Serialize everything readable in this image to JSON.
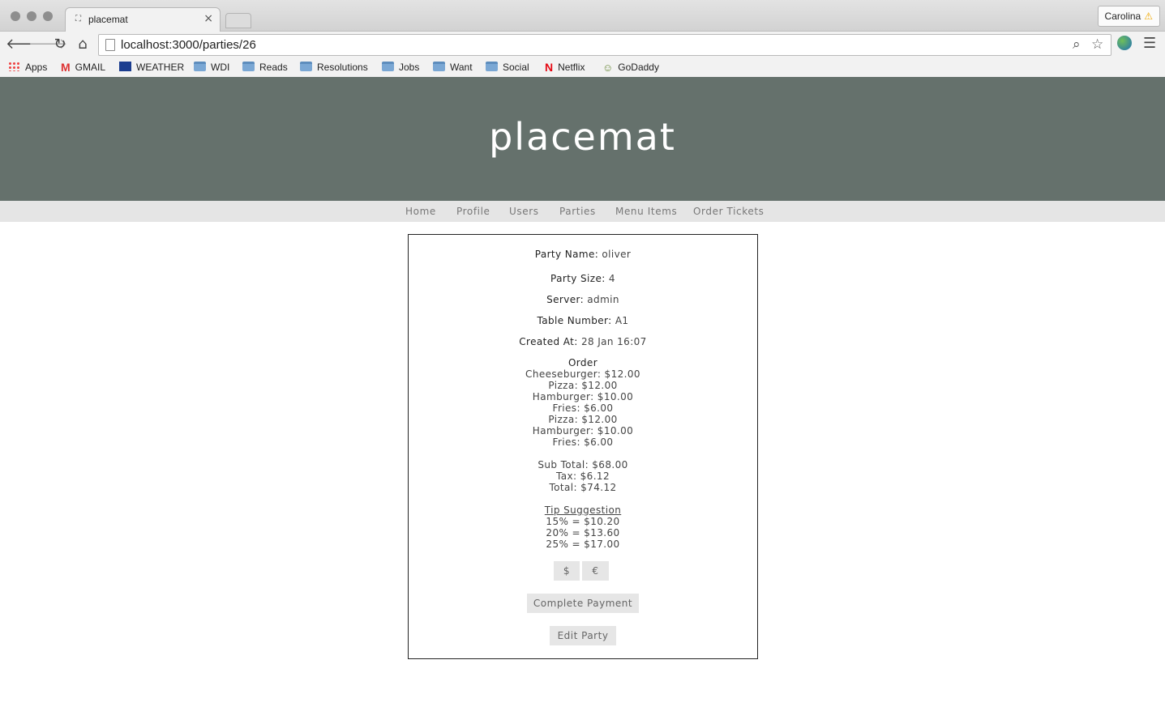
{
  "browser": {
    "tab_title": "placemat",
    "tab_close": "×",
    "url": "localhost:3000/parties/26",
    "profile_name": "Carolina",
    "bookmarks": [
      {
        "label": "Apps",
        "icon": "apps-icon"
      },
      {
        "label": "GMAIL",
        "icon": "gmail-icon"
      },
      {
        "label": "WEATHER",
        "icon": "weather-icon"
      },
      {
        "label": "WDI",
        "icon": "folder-icon"
      },
      {
        "label": "Reads",
        "icon": "folder-icon"
      },
      {
        "label": "Resolutions",
        "icon": "folder-icon"
      },
      {
        "label": "Jobs",
        "icon": "folder-icon"
      },
      {
        "label": "Want",
        "icon": "folder-icon"
      },
      {
        "label": "Social",
        "icon": "folder-icon"
      },
      {
        "label": "Netflix",
        "icon": "netflix-icon"
      },
      {
        "label": "GoDaddy",
        "icon": "godaddy-icon"
      }
    ]
  },
  "site": {
    "logo": "placemat",
    "nav": [
      "Home",
      "Profile",
      "Users",
      "Parties",
      "Menu Items",
      "Order Tickets"
    ]
  },
  "party": {
    "name_label": "Party Name:",
    "name": "oliver",
    "size_label": "Party Size:",
    "size": "4",
    "server_label": "Server:",
    "server": "admin",
    "table_label": "Table Number:",
    "table": "A1",
    "created_label": "Created At:",
    "created": "28 Jan 16:07",
    "order_heading": "Order",
    "order_items": [
      "Cheeseburger: $12.00",
      "Pizza: $12.00",
      "Hamburger: $10.00",
      "Fries: $6.00",
      "Pizza: $12.00",
      "Hamburger: $10.00",
      "Fries: $6.00"
    ],
    "subtotal": "Sub Total: $68.00",
    "tax": "Tax: $6.12",
    "total": "Total: $74.12",
    "tip_heading": "Tip Suggestion",
    "tips": [
      "15% = $10.20",
      "20% = $13.60",
      "25% = $17.00"
    ],
    "currency_buttons": [
      "$",
      "€"
    ],
    "complete_payment": "Complete Payment",
    "edit_party": "Edit Party"
  },
  "colors": {
    "header_bg": "#65716c",
    "nav_bg": "#e5e5e5",
    "button_bg": "#e6e6e6"
  }
}
